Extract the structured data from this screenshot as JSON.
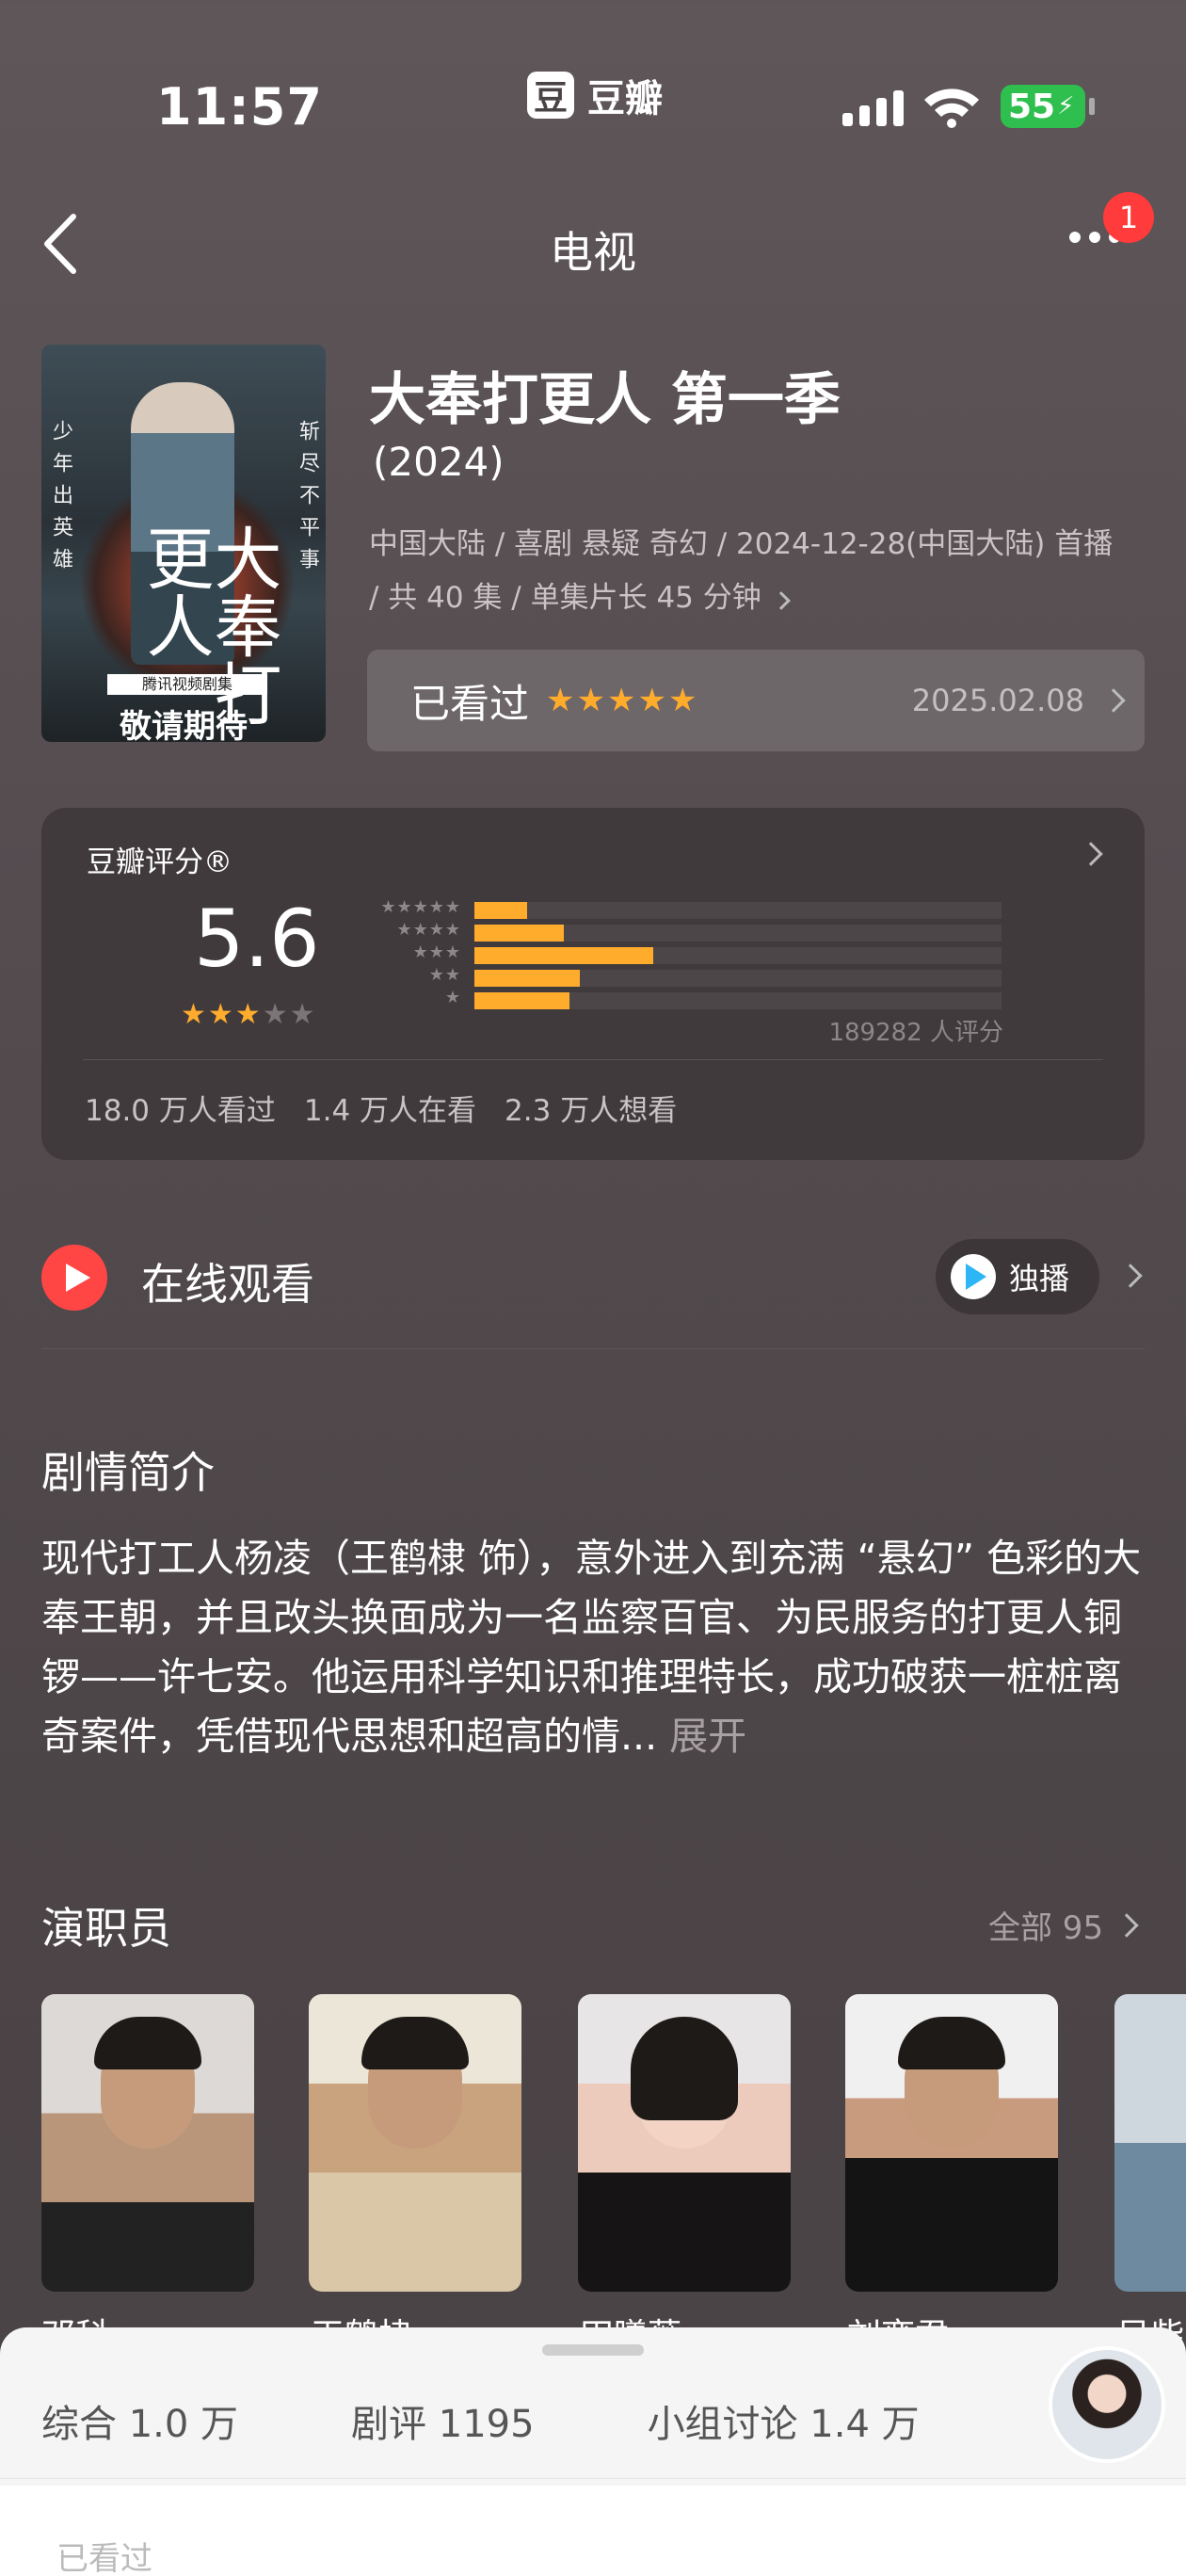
{
  "status_bar": {
    "time": "11:57",
    "app_logo": "豆",
    "app_name": "豆瓣",
    "battery": "55"
  },
  "nav": {
    "title": "电视",
    "notification_count": "1"
  },
  "show": {
    "title": "大奉打更人 第一季",
    "year": "(2024)",
    "meta": "中国大陆 / 喜剧 悬疑 奇幻 / 2024-12-28(中国大陆) 首播 / 共 40 集 / 单集片长 45 分钟",
    "poster": {
      "side_left": "少年出英雄",
      "side_right": "斩尽不平事",
      "title": "大奉打更人",
      "band": "腾讯视频剧集",
      "coming": "敬请期待"
    }
  },
  "watched": {
    "label": "已看过",
    "stars": "★★★★★",
    "date": "2025.02.08"
  },
  "rating": {
    "label": "豆瓣评分®",
    "score": "5.6",
    "stars_on": "★★★",
    "stars_off": "★★",
    "distribution_pct": [
      10,
      17,
      34,
      20,
      18
    ],
    "count": "189282 人评分",
    "watched_count": "18.0 万人看过",
    "watching_count": "1.4 万人在看",
    "want_count": "2.3 万人想看"
  },
  "online": {
    "label": "在线观看",
    "exclusive": "独播"
  },
  "synopsis": {
    "title": "剧情简介",
    "text": "现代打工人杨凌（王鹤棣 饰），意外进入到充满 “悬幻” 色彩的大奉王朝，并且改头换面成为一名监察百官、为民服务的打更人铜锣——许七安。他运用科学知识和推理特长，成功破获一桩桩离奇案件，凭借现代思想和超高的情...",
    "expand": "展开"
  },
  "cast": {
    "title": "演职员",
    "all": "全部 95",
    "members": [
      "邓科",
      "王鹤棣",
      "田曦薇",
      "刘奕君",
      "吴柴"
    ]
  },
  "sheet": {
    "tabs": [
      "综合 1.0 万",
      "剧评 1195",
      "小组讨论 1.4 万"
    ],
    "partial": "已看过"
  },
  "colors": {
    "accent": "#ffac2d",
    "play": "#ff4645",
    "battery": "#2fbf4f"
  }
}
